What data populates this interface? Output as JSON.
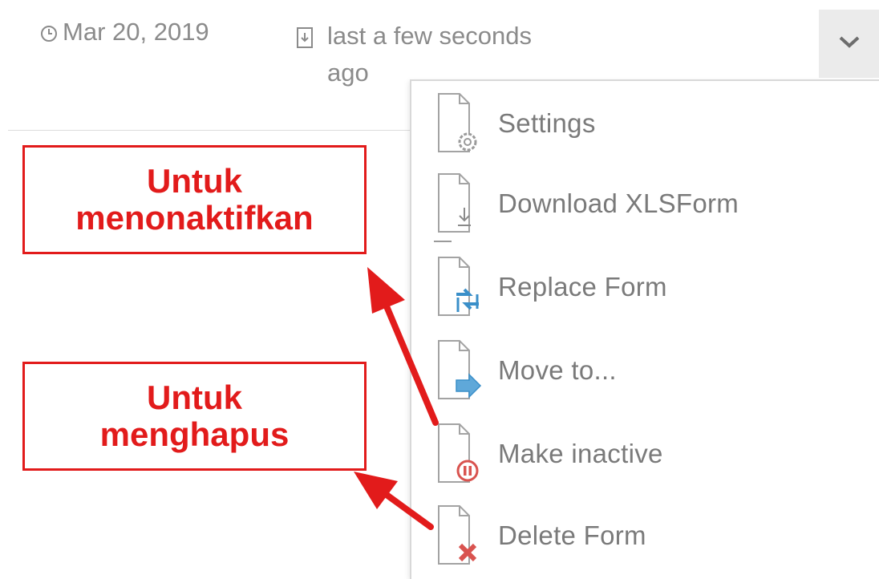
{
  "meta": {
    "date": "Mar 20, 2019",
    "modified_line1": "last a few seconds",
    "modified_line2": "ago"
  },
  "menu_items": [
    {
      "label": "Settings",
      "icon": "settings-doc-icon"
    },
    {
      "label": "Download XLSForm",
      "icon": "download-doc-icon"
    },
    {
      "label": "Replace Form",
      "icon": "replace-doc-icon"
    },
    {
      "label": "Move to...",
      "icon": "move-doc-icon"
    },
    {
      "label": "Make inactive",
      "icon": "inactive-doc-icon"
    },
    {
      "label": "Delete Form",
      "icon": "delete-doc-icon"
    }
  ],
  "annotations": {
    "deactivate": {
      "line1": "Untuk",
      "line2": "menonaktifkan"
    },
    "delete": {
      "line1": "Untuk",
      "line2": "menghapus"
    }
  },
  "colors": {
    "annotation_red": "#e21b1b",
    "menu_text": "#7a7a7a",
    "icon_blue": "#3a8fc9",
    "delete_red": "#d9534f"
  }
}
